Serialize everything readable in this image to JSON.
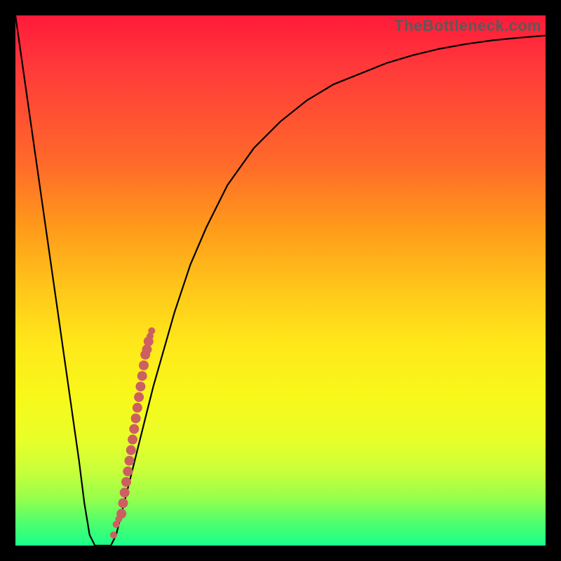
{
  "attribution": "TheBottleneck.com",
  "colors": {
    "frame": "#000000",
    "gradient_top": "#ff1a3a",
    "gradient_bottom": "#18ff8a",
    "curve": "#000000",
    "dots": "#cc6060"
  },
  "chart_data": {
    "type": "line",
    "title": "",
    "xlabel": "",
    "ylabel": "",
    "xlim": [
      0,
      100
    ],
    "ylim": [
      0,
      100
    ],
    "series": [
      {
        "name": "bottleneck-curve",
        "x": [
          0,
          5,
          8,
          10,
          12,
          13,
          14,
          15,
          16,
          17,
          18,
          19,
          20,
          22,
          24,
          26,
          28,
          30,
          33,
          36,
          40,
          45,
          50,
          55,
          60,
          65,
          70,
          75,
          80,
          85,
          90,
          95,
          100
        ],
        "y": [
          100,
          65,
          44,
          30,
          16,
          8,
          2,
          0,
          0,
          0,
          0,
          2,
          6,
          14,
          22,
          30,
          37,
          44,
          53,
          60,
          68,
          75,
          80,
          84,
          87,
          89,
          91,
          92.5,
          93.7,
          94.6,
          95.3,
          95.8,
          96.2
        ]
      }
    ],
    "scatter_overlay": {
      "name": "sample-points",
      "x": [
        18.5,
        19.0,
        19.5,
        20.0,
        20.3,
        20.6,
        20.9,
        21.2,
        21.5,
        21.8,
        22.1,
        22.4,
        22.7,
        23.0,
        23.3,
        23.6,
        23.9,
        24.2,
        24.5,
        24.8,
        25.1,
        25.4,
        25.7
      ],
      "y": [
        2,
        4,
        5,
        6,
        8,
        10,
        12,
        14,
        16,
        18,
        20,
        22,
        24,
        26,
        28,
        30,
        32,
        34,
        36,
        37,
        38.5,
        39.5,
        40.5
      ]
    }
  }
}
